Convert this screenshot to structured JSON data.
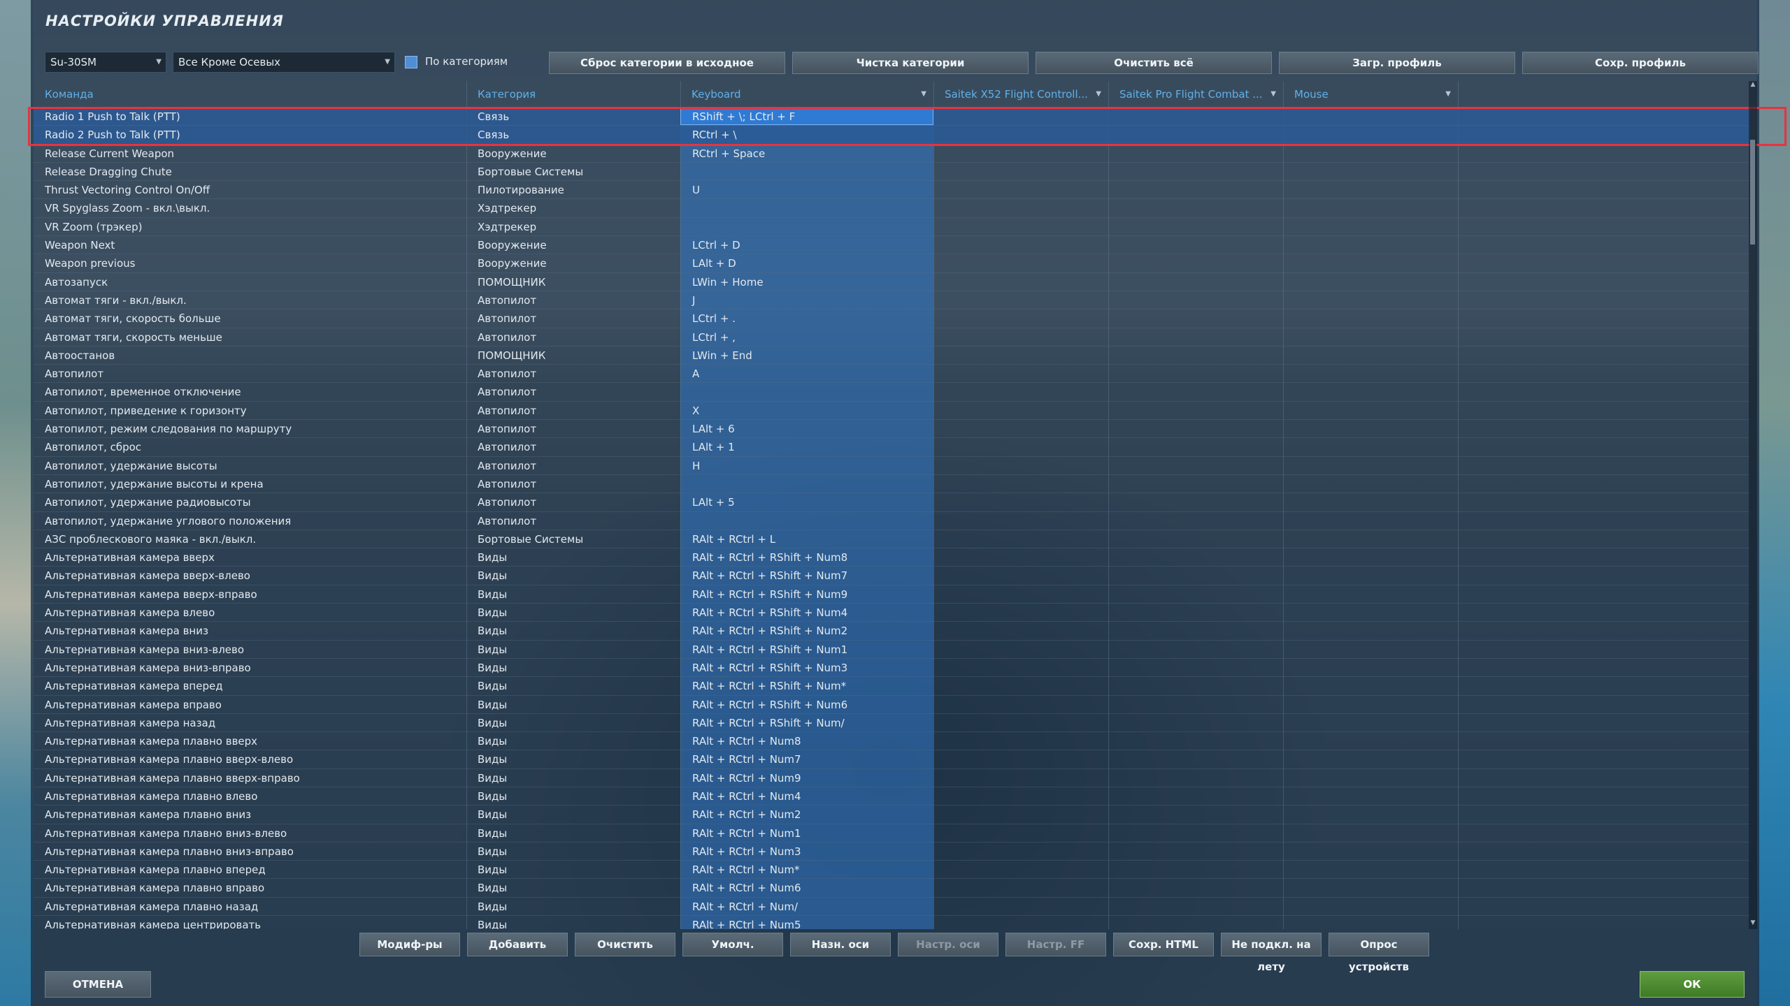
{
  "window": {
    "title": "НАСТРОЙКИ УПРАВЛЕНИЯ"
  },
  "toolbar": {
    "aircraft_value": "Su-30SM",
    "filter_value": "Все Кроме Осевых",
    "by_category_label": "По категориям",
    "by_category_checked": true,
    "buttons": [
      "Сброс категории в исходное",
      "Чистка категории",
      "Очистить всё",
      "Загр. профиль",
      "Сохр. профиль"
    ]
  },
  "table": {
    "columns": [
      "Команда",
      "Категория",
      "Keyboard",
      "Saitek X52 Flight Controll...",
      "Saitek Pro Flight Combat ...",
      "Mouse"
    ],
    "rows": [
      [
        "Radio 1 Push to Talk (PTT)",
        "Связь",
        "RShift + \\; LCtrl + F"
      ],
      [
        "Radio 2 Push to Talk (PTT)",
        "Связь",
        "RCtrl + \\"
      ],
      [
        "Release Current Weapon",
        "Вооружение",
        "RCtrl + Space"
      ],
      [
        "Release Dragging Chute",
        "Бортовые Системы",
        ""
      ],
      [
        "Thrust Vectoring Control On/Off",
        "Пилотирование",
        "U"
      ],
      [
        "VR Spyglass Zoom - вкл.\\выкл.",
        "Хэдтрекер",
        ""
      ],
      [
        "VR Zoom (трэкер)",
        "Хэдтрекер",
        ""
      ],
      [
        "Weapon Next",
        "Вооружение",
        "LCtrl + D"
      ],
      [
        "Weapon previous",
        "Вооружение",
        "LAlt + D"
      ],
      [
        "Автозапуск",
        "ПОМОЩНИК",
        "LWin + Home"
      ],
      [
        "Автомат тяги - вкл./выкл.",
        "Автопилот",
        "J"
      ],
      [
        "Автомат тяги, скорость больше",
        "Автопилот",
        "LCtrl + ."
      ],
      [
        "Автомат тяги, скорость меньше",
        "Автопилот",
        "LCtrl + ,"
      ],
      [
        "Автоостанов",
        "ПОМОЩНИК",
        "LWin + End"
      ],
      [
        "Автопилот",
        "Автопилот",
        "A"
      ],
      [
        "Автопилот, временное отключение",
        "Автопилот",
        ""
      ],
      [
        "Автопилот, приведение к горизонту",
        "Автопилот",
        "X"
      ],
      [
        "Автопилот, режим следования по маршруту",
        "Автопилот",
        "LAlt + 6"
      ],
      [
        "Автопилот, сброс",
        "Автопилот",
        "LAlt + 1"
      ],
      [
        "Автопилот, удержание высоты",
        "Автопилот",
        "H"
      ],
      [
        "Автопилот, удержание высоты и крена",
        "Автопилот",
        ""
      ],
      [
        "Автопилот, удержание радиовысоты",
        "Автопилот",
        "LAlt + 5"
      ],
      [
        "Автопилот, удержание углового положения",
        "Автопилот",
        ""
      ],
      [
        "АЗС проблескового маяка - вкл./выкл.",
        "Бортовые Системы",
        "RAlt + RCtrl + L"
      ],
      [
        "Альтернативная камера вверх",
        "Виды",
        "RAlt + RCtrl + RShift + Num8"
      ],
      [
        "Альтернативная камера вверх-влево",
        "Виды",
        "RAlt + RCtrl + RShift + Num7"
      ],
      [
        "Альтернативная камера вверх-вправо",
        "Виды",
        "RAlt + RCtrl + RShift + Num9"
      ],
      [
        "Альтернативная камера влево",
        "Виды",
        "RAlt + RCtrl + RShift + Num4"
      ],
      [
        "Альтернативная камера вниз",
        "Виды",
        "RAlt + RCtrl + RShift + Num2"
      ],
      [
        "Альтернативная камера вниз-влево",
        "Виды",
        "RAlt + RCtrl + RShift + Num1"
      ],
      [
        "Альтернативная камера вниз-вправо",
        "Виды",
        "RAlt + RCtrl + RShift + Num3"
      ],
      [
        "Альтернативная камера вперед",
        "Виды",
        "RAlt + RCtrl + RShift + Num*"
      ],
      [
        "Альтернативная камера вправо",
        "Виды",
        "RAlt + RCtrl + RShift + Num6"
      ],
      [
        "Альтернативная камера назад",
        "Виды",
        "RAlt + RCtrl + RShift + Num/"
      ],
      [
        "Альтернативная камера плавно вверх",
        "Виды",
        "RAlt + RCtrl + Num8"
      ],
      [
        "Альтернативная камера плавно вверх-влево",
        "Виды",
        "RAlt + RCtrl + Num7"
      ],
      [
        "Альтернативная камера плавно вверх-вправо",
        "Виды",
        "RAlt + RCtrl + Num9"
      ],
      [
        "Альтернативная камера плавно влево",
        "Виды",
        "RAlt + RCtrl + Num4"
      ],
      [
        "Альтернативная камера плавно вниз",
        "Виды",
        "RAlt + RCtrl + Num2"
      ],
      [
        "Альтернативная камера плавно вниз-влево",
        "Виды",
        "RAlt + RCtrl + Num1"
      ],
      [
        "Альтернативная камера плавно вниз-вправо",
        "Виды",
        "RAlt + RCtrl + Num3"
      ],
      [
        "Альтернативная камера плавно вперед",
        "Виды",
        "RAlt + RCtrl + Num*"
      ],
      [
        "Альтернативная камера плавно вправо",
        "Виды",
        "RAlt + RCtrl + Num6"
      ],
      [
        "Альтернативная камера плавно назад",
        "Виды",
        "RAlt + RCtrl + Num/"
      ],
      [
        "Альтернативная камера центрировать",
        "Виды",
        "RAlt + RCtrl + Num5"
      ]
    ]
  },
  "bottom_buttons": [
    "Модиф-ры",
    "Добавить",
    "Очистить",
    "Умолч.",
    "Назн. оси",
    "Настр. оси",
    "Настр. FF",
    "Сохр. HTML",
    "Не подкл. на лету",
    "Опрос устройств"
  ],
  "footer": {
    "cancel_label": "ОТМЕНА",
    "ok_label": "ОК"
  },
  "colors": {
    "accent": "#5fb1ea",
    "selection": "#2f7ad3",
    "highlight": "#e8333f",
    "ok": "#4f8d33"
  }
}
